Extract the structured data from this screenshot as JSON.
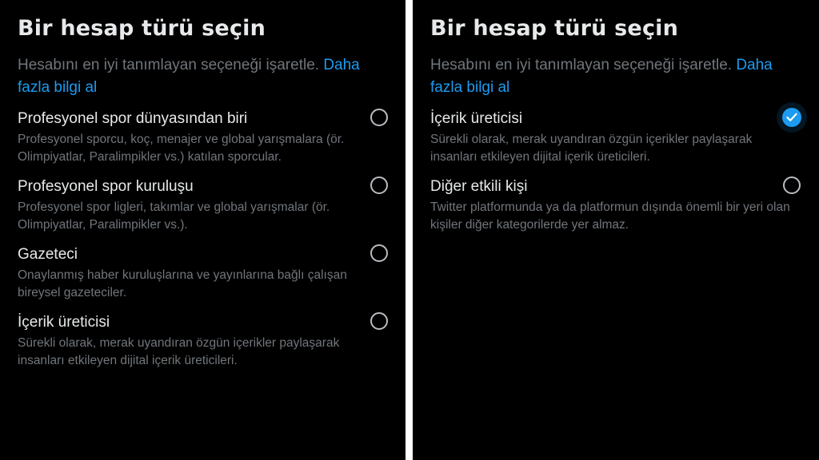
{
  "colors": {
    "background": "#000000",
    "text_primary": "#e7e9ea",
    "text_secondary": "#71767b",
    "accent": "#1d9bf0"
  },
  "left_panel": {
    "title": "Bir hesap türü seçin",
    "subtitle": "Hesabını en iyi tanımlayan seçeneği işaretle.",
    "link": "Daha fazla bilgi al",
    "options": [
      {
        "label": "Profesyonel spor dünyasından biri",
        "description": "Profesyonel sporcu, koç, menajer ve global yarışmalara (ör. Olimpiyatlar, Paralimpikler vs.) katılan sporcular.",
        "selected": false
      },
      {
        "label": "Profesyonel spor kuruluşu",
        "description": "Profesyonel spor ligleri, takımlar ve global yarışmalar (ör. Olimpiyatlar, Paralimpikler vs.).",
        "selected": false
      },
      {
        "label": "Gazeteci",
        "description": "Onaylanmış haber kuruluşlarına ve yayınlarına bağlı çalışan bireysel gazeteciler.",
        "selected": false
      },
      {
        "label": "İçerik üreticisi",
        "description": "Sürekli olarak, merak uyandıran özgün içerikler paylaşarak insanları etkileyen dijital içerik üreticileri.",
        "selected": false
      }
    ]
  },
  "right_panel": {
    "title": "Bir hesap türü seçin",
    "subtitle": "Hesabını en iyi tanımlayan seçeneği işaretle.",
    "link": "Daha fazla bilgi al",
    "options": [
      {
        "label": "İçerik üreticisi",
        "description": "Sürekli olarak, merak uyandıran özgün içerikler paylaşarak insanları etkileyen dijital içerik üreticileri.",
        "selected": true
      },
      {
        "label": "Diğer etkili kişi",
        "description": "Twitter platformunda ya da platformun dışında önemli bir yeri olan kişiler diğer kategorilerde yer almaz.",
        "selected": false
      }
    ]
  }
}
